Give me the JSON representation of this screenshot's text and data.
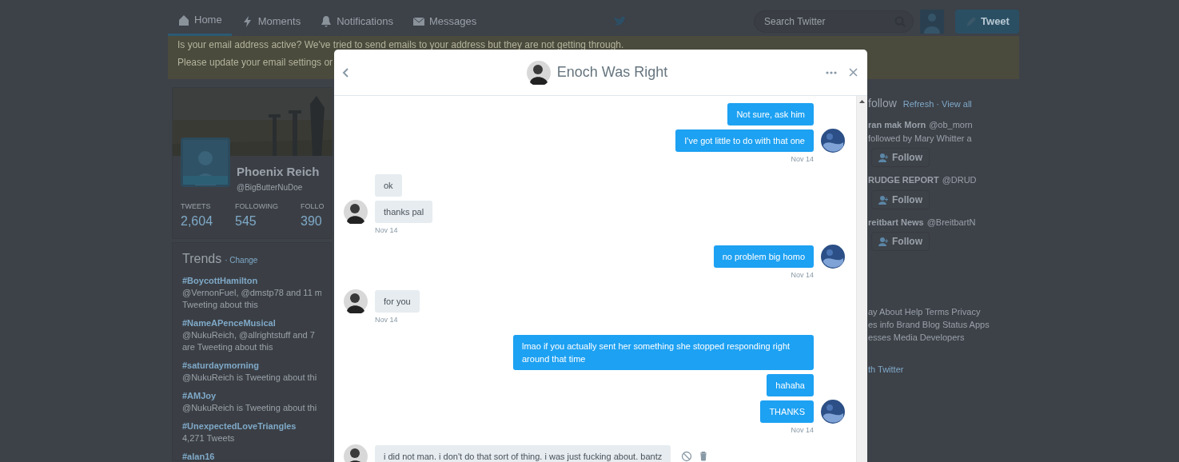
{
  "nav": {
    "tabs": [
      {
        "label": "Home",
        "selected": true
      },
      {
        "label": "Moments",
        "selected": false
      },
      {
        "label": "Notifications",
        "selected": false
      },
      {
        "label": "Messages",
        "selected": false
      }
    ],
    "search": {
      "placeholder": "Search Twitter"
    },
    "tweet_button": "Tweet"
  },
  "email_banner": {
    "line_1": "Is your email address active? We've tried to send emails to your address but they are not getting through.",
    "line_2": "Please update your email settings or"
  },
  "profile": {
    "name": "Phoenix Reich",
    "handle": "@BigButterNuDoe",
    "stats": [
      {
        "label": "TWEETS",
        "value": "2,604"
      },
      {
        "label": "FOLLOWING",
        "value": "545"
      },
      {
        "label": "FOLLO",
        "value": "390"
      }
    ]
  },
  "trends": {
    "title": "Trends",
    "change": "· Change",
    "items": [
      {
        "tag": "#BoycottHamilton",
        "lines": [
          "@VernonFuel, @dmstp78 and 11 m",
          "Tweeting about this"
        ]
      },
      {
        "tag": "#NameAPenceMusical",
        "lines": [
          "@NukuReich, @allrightstuff and 7",
          "are Tweeting about this"
        ]
      },
      {
        "tag": "#saturdaymorning",
        "lines": [
          "@NukuReich is Tweeting about thi"
        ]
      },
      {
        "tag": "#AMJoy",
        "lines": [
          "@NukuReich is Tweeting about thi"
        ]
      },
      {
        "tag": "#UnexpectedLoveTriangles",
        "lines": [
          "4,271 Tweets"
        ]
      },
      {
        "tag": "#alan16"
      }
    ]
  },
  "who_to_follow": {
    "title": "follow",
    "links": "Refresh · View all",
    "accounts": [
      {
        "name": "ran mak Morn",
        "handle": "@ob_morn",
        "note": "followed by Mary Whitter a",
        "follow": "Follow"
      },
      {
        "name": "RUDGE REPORT",
        "handle": "@DRUD",
        "follow": "Follow"
      },
      {
        "name": "reitbart News",
        "handle": "@BreitbartN",
        "follow": "Follow"
      }
    ]
  },
  "footer": [
    "ay  About  Help  Terms  Privacy",
    "es info  Brand  Blog  Status  Apps",
    "esses  Media  Developers"
  ],
  "footer_note": "th Twitter",
  "dm": {
    "title": "Enoch Was Right",
    "messages": [
      {
        "kind": "sent",
        "text": "Not sure, ask him",
        "avatar": false
      },
      {
        "kind": "sent",
        "text": "I've got little to do with that one",
        "avatar": true,
        "time": "Nov 14"
      },
      {
        "kind": "received",
        "text": "ok",
        "avatar": false
      },
      {
        "kind": "received",
        "text": "thanks pal",
        "avatar": true,
        "time": "Nov 14"
      },
      {
        "kind": "sent",
        "text": "no problem big homo",
        "avatar": true,
        "time": "Nov 14"
      },
      {
        "kind": "received",
        "text": "for you",
        "avatar": true,
        "time": "Nov 14"
      },
      {
        "kind": "sent",
        "text": "lmao if you actually sent her something she stopped responding right around that time",
        "avatar": false
      },
      {
        "kind": "sent",
        "text": "hahaha",
        "avatar": false
      },
      {
        "kind": "sent",
        "text": "THANKS",
        "avatar": true,
        "time": "Nov 14"
      },
      {
        "kind": "received",
        "text": "i did not man. i don't do that sort of thing. i was just fucking about. bantz",
        "avatar": true,
        "actions": true
      }
    ]
  }
}
